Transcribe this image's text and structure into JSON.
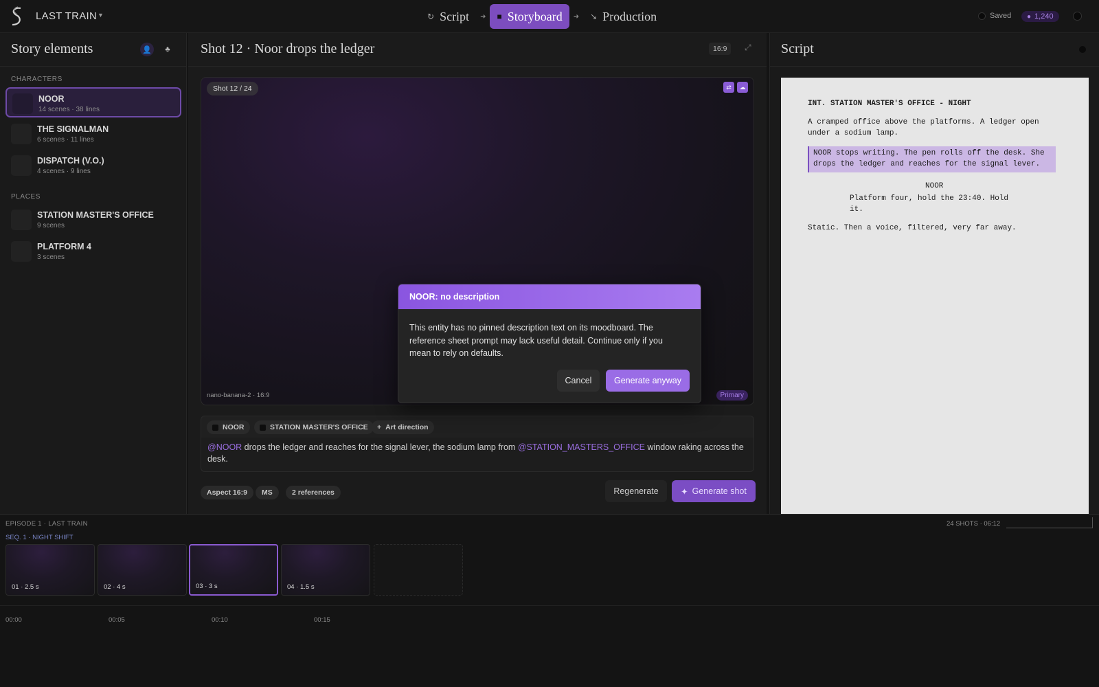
{
  "topbar": {
    "project_name": "LAST TRAIN",
    "nav": [
      {
        "label": "Script",
        "icon": "script-icon"
      },
      {
        "label": "Storyboard",
        "icon": "storyboard-icon",
        "active": true
      },
      {
        "label": "Production",
        "icon": "production-icon"
      }
    ],
    "saved_label": "Saved",
    "credits": "1,240"
  },
  "left": {
    "title": "Story elements",
    "characters_label": "CHARACTERS",
    "characters": [
      {
        "name": "NOOR",
        "meta": "14 scenes · 38 lines",
        "selected": true
      },
      {
        "name": "THE SIGNALMAN",
        "meta": "6 scenes · 11 lines"
      },
      {
        "name": "DISPATCH (V.O.)",
        "meta": "4 scenes · 9 lines"
      }
    ],
    "places_label": "PLACES",
    "places": [
      {
        "name": "STATION MASTER'S OFFICE",
        "meta": "9 scenes"
      },
      {
        "name": "PLATFORM 4",
        "meta": "3 scenes"
      }
    ]
  },
  "center": {
    "shot_title": "Shot 12 · Noor drops the ledger",
    "aspect": "16:9",
    "shot_badge": "Shot 12 / 24",
    "model_label": "nano-banana-2 · 16:9",
    "primary_label": "Primary",
    "tags": [
      "NOOR",
      "STATION MASTER'S OFFICE",
      "Art direction"
    ],
    "prompt": {
      "mention1": "@NOOR",
      "text1": " drops the ledger and reaches for the signal lever, the sodium lamp from ",
      "mention2": "@STATION_MASTERS_OFFICE",
      "text2": " window raking across the desk."
    },
    "chips": [
      "Aspect 16:9",
      "MS",
      "2 references"
    ],
    "regenerate_label": "Regenerate",
    "generate_label": "Generate shot"
  },
  "right": {
    "title": "Script",
    "script": {
      "slug": "INT. STATION MASTER'S OFFICE - NIGHT",
      "action1_l1": "A cramped office above the platforms. A ledger open",
      "action1_l2": "under a sodium lamp.",
      "hl_l1": "NOOR stops writing. The pen rolls off the desk. She",
      "hl_l2": "drops the ledger and reaches for the signal lever.",
      "character": "NOOR",
      "dialogue_l1": "Platform four, hold the 23:40. Hold",
      "dialogue_l2": "it.",
      "action2": "Static. Then a voice, filtered, very far away."
    }
  },
  "timeline": {
    "episode": "EPISODE 1 · LAST TRAIN",
    "stats": "24 SHOTS · 06:12",
    "sequence": "SEQ. 1 · NIGHT SHIFT",
    "clips": [
      "01 · 2.5 s",
      "02 · 4 s",
      "03 · 3 s",
      "04 · 1.5 s"
    ],
    "ticks": [
      "00:00",
      "00:05",
      "00:10",
      "00:15"
    ]
  },
  "modal": {
    "title": "NOOR: no description",
    "body": "This entity has no pinned description text on its moodboard. The reference sheet prompt may lack useful detail. Continue only if you mean to rely on defaults.",
    "cancel_label": "Cancel",
    "confirm_label": "Generate anyway"
  },
  "colors": {
    "accent": "#7c4dbf",
    "accent_light": "#9a6ce6",
    "mention": "#9a6ee0"
  }
}
